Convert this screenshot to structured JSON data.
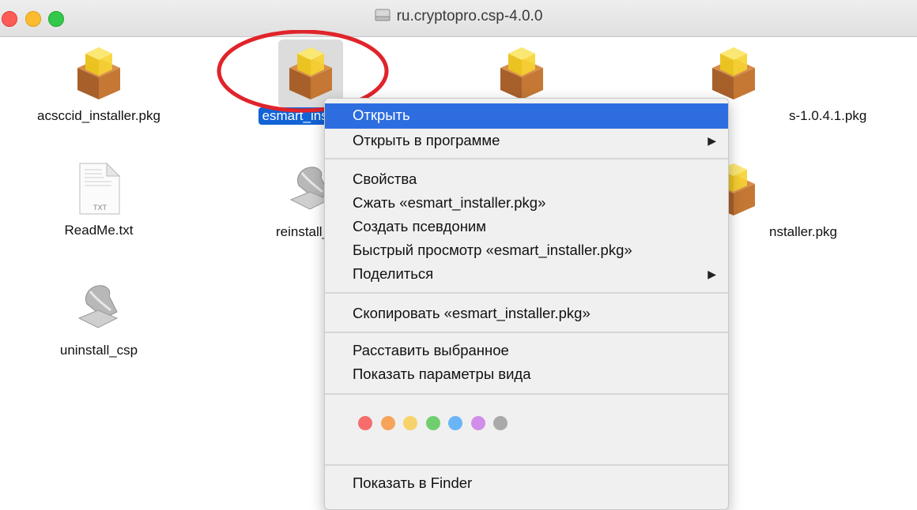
{
  "window": {
    "title": "ru.cryptopro.csp-4.0.0"
  },
  "files": [
    {
      "name": "acsccid_installer.pkg",
      "icon": "package-icon"
    },
    {
      "name": "esmart_inst",
      "icon": "package-icon",
      "selected": true
    },
    {
      "name": "",
      "icon": "package-icon"
    },
    {
      "name": "s-1.0.4.1.pkg",
      "icon": "package-icon"
    },
    {
      "name": "ReadMe.txt",
      "icon": "txt-file-icon",
      "badge": "TXT"
    },
    {
      "name": "reinstall_",
      "icon": "script-icon"
    },
    {
      "name": "nstaller.pkg",
      "icon": "package-icon"
    },
    {
      "name": "uninstall_csp",
      "icon": "script-icon"
    }
  ],
  "context_menu": {
    "items": {
      "open": "Открыть",
      "open_with": "Открыть в программе",
      "get_info": "Свойства",
      "compress": "Сжать «esmart_installer.pkg»",
      "make_alias": "Создать псевдоним",
      "quick_look": "Быстрый просмотр «esmart_installer.pkg»",
      "share": "Поделиться",
      "copy": "Скопировать «esmart_installer.pkg»",
      "arrange": "Расставить выбранное",
      "view_options": "Показать параметры вида",
      "show_in_finder": "Показать в Finder"
    },
    "submenu_arrow": "▶",
    "tag_colors": [
      "#f56e6b",
      "#f6a45b",
      "#f6d36a",
      "#6fcf6f",
      "#6ab5f6",
      "#d08ee8",
      "#a9a9a9"
    ]
  },
  "colors": {
    "selection": "#1263d6",
    "menu_highlight": "#2d6de0",
    "annotation": "#e0242b"
  }
}
